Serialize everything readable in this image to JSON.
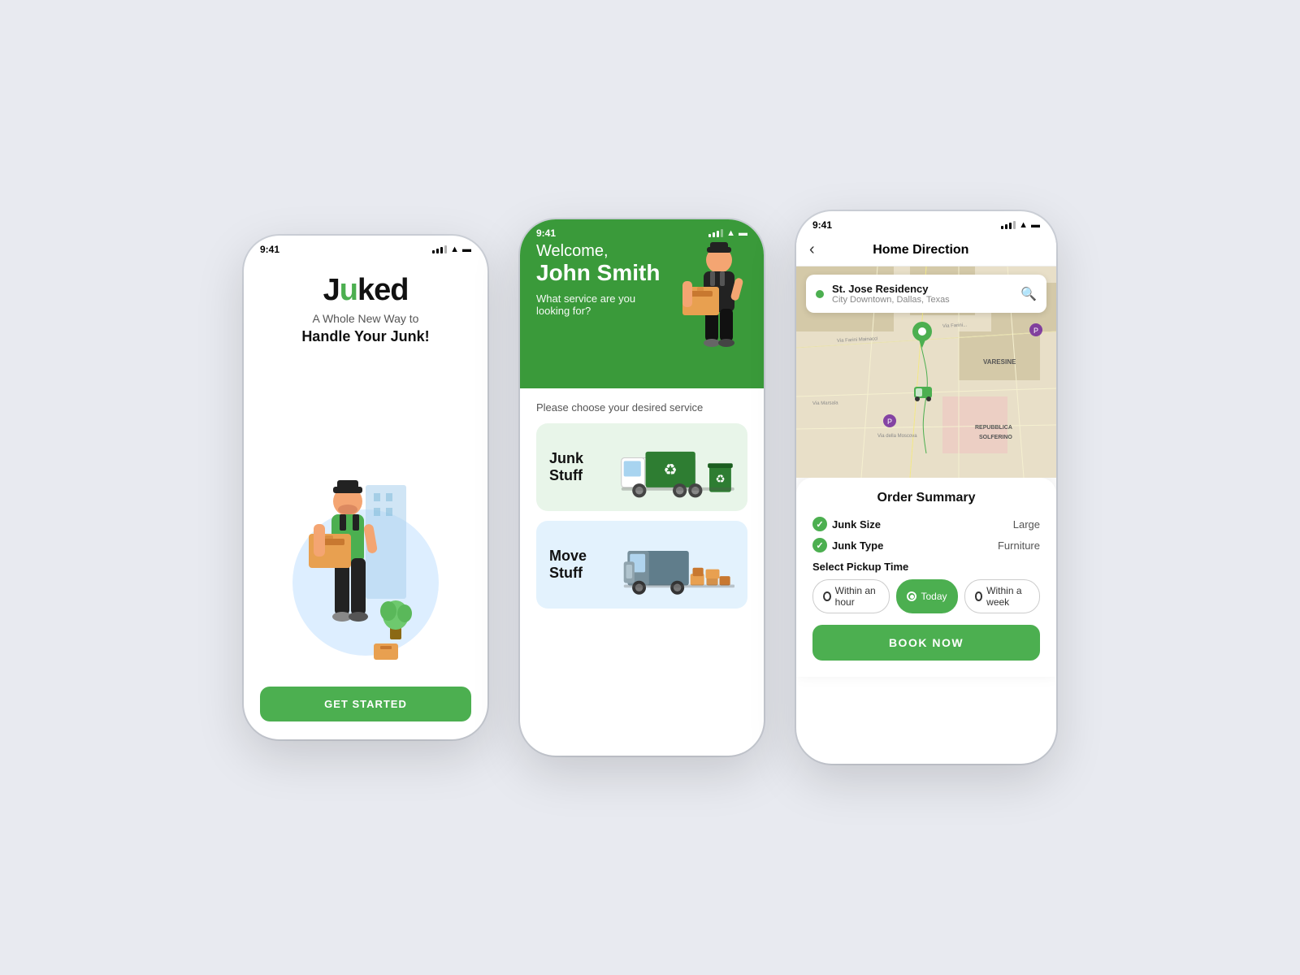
{
  "screen1": {
    "status_time": "9:41",
    "logo": "Juked",
    "tagline_normal": "A Whole New Way to",
    "tagline_bold": "Handle Your Junk!",
    "cta_button": "GET STARTED"
  },
  "screen2": {
    "status_time": "9:41",
    "welcome_hi": "Welcome,",
    "welcome_name": "John Smith",
    "welcome_question": "What service are you\nlooking for?",
    "choose_text": "Please choose your desired service",
    "service1_title": "Junk Stuff",
    "service2_title": "Move Stuff"
  },
  "screen3": {
    "status_time": "9:41",
    "nav_title": "Home Direction",
    "location_name": "St. Jose Residency",
    "location_sub": "City Downtown, Dallas, Texas",
    "summary_title": "Order Summary",
    "junk_size_label": "Junk Size",
    "junk_size_value": "Large",
    "junk_type_label": "Junk Type",
    "junk_type_value": "Furniture",
    "pickup_label": "Select Pickup Time",
    "option1": "Within an hour",
    "option2": "Today",
    "option3": "Within a week",
    "book_btn": "BOOK NOW"
  },
  "colors": {
    "green": "#4caf50",
    "dark_green": "#3a9a3a",
    "light_green_bg": "#e8f5e9",
    "light_blue_bg": "#e3f2fd"
  }
}
